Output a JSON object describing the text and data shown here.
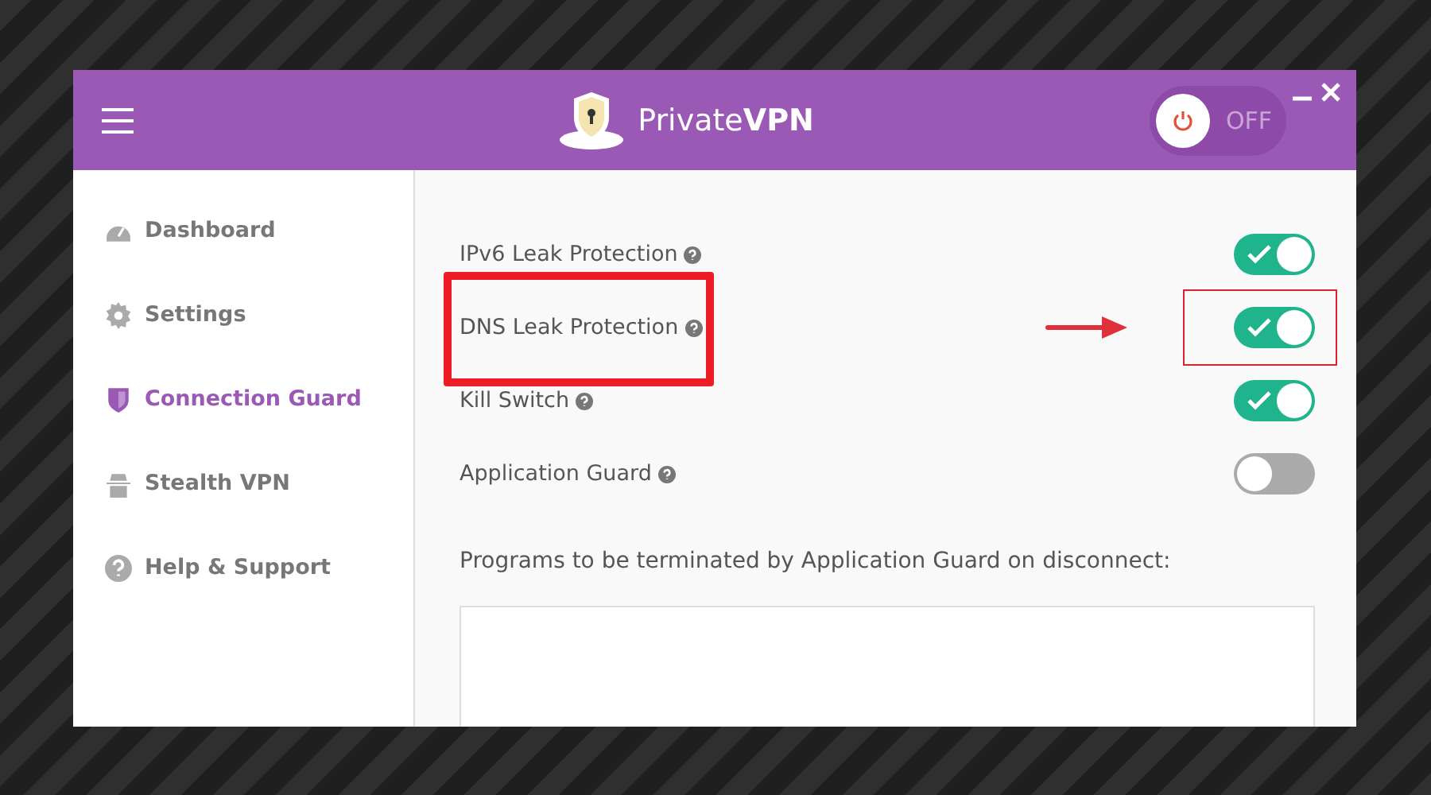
{
  "header": {
    "logo": "Private**VPN**",
    "power": {
      "label": "OFF",
      "on": false
    }
  },
  "sidebar": {
    "items": [
      {
        "label": "Dashboard",
        "kind": "dashboard",
        "selected": false
      },
      {
        "label": "Settings",
        "kind": "settings",
        "selected": false
      },
      {
        "label": "Connection Guard",
        "kind": "shield",
        "selected": true
      },
      {
        "label": "Stealth VPN",
        "kind": "stealth",
        "selected": false
      },
      {
        "label": "Help & Support",
        "kind": "help",
        "selected": false
      }
    ]
  },
  "settings": [
    {
      "label": "IPv6 Leak Protection",
      "on": true,
      "highlighted": false
    },
    {
      "label": "DNS Leak Protection",
      "on": true,
      "highlighted": true
    },
    {
      "label": "Kill Switch",
      "on": true,
      "highlighted": false
    },
    {
      "label": "Application Guard",
      "on": false,
      "highlighted": false
    }
  ],
  "programs": {
    "label": "Programs to be terminated by Application Guard on disconnect:"
  }
}
